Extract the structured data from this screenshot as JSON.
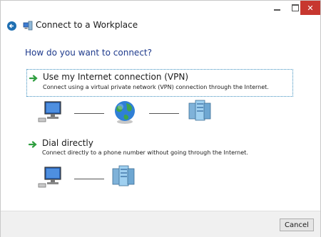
{
  "window": {
    "title": "Connect to a Workplace",
    "controls": {
      "minimize_icon": "minimize-icon",
      "maximize_icon": "maximize-icon",
      "close_icon": "close-icon"
    }
  },
  "main": {
    "question": "How do you want to connect?",
    "options": [
      {
        "title": "Use my Internet connection (VPN)",
        "description": "Connect using a virtual private network (VPN) connection through the Internet.",
        "selected": true,
        "diagram": [
          "computer-icon",
          "globe-icon",
          "server-icon"
        ]
      },
      {
        "title": "Dial directly",
        "description": "Connect directly to a phone number without going through the Internet.",
        "selected": false,
        "diagram": [
          "computer-icon",
          "server-icon"
        ]
      }
    ]
  },
  "footer": {
    "cancel_label": "Cancel"
  },
  "colors": {
    "question_text": "#1e3a8c",
    "selection_border": "#3c8fbf",
    "close_button": "#c7372f",
    "arrow_green": "#2f9e3f"
  }
}
